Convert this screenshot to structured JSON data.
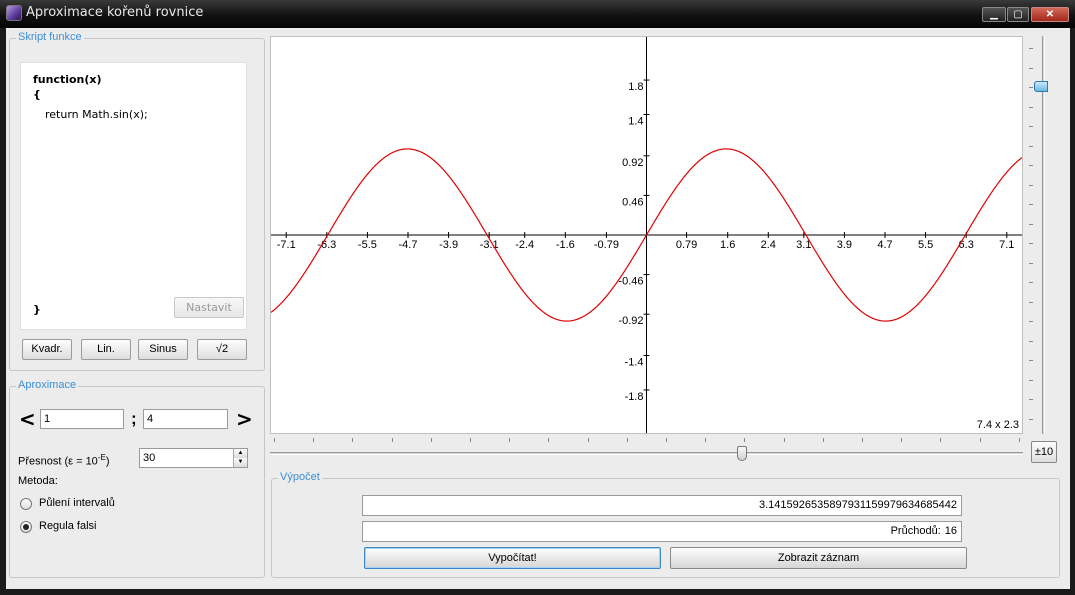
{
  "window": {
    "title": "Aproximace kořenů rovnice",
    "controls": {
      "minimize": "▁",
      "maximize": "▢",
      "close": "✕"
    }
  },
  "script_panel": {
    "title": "Skript funkce",
    "code_lines": [
      "function(x)",
      "{",
      "return Math.sin(x);",
      "}"
    ],
    "apply_button": "Nastavit",
    "preset_buttons": [
      "Kvadr.",
      "Lin.",
      "Sinus",
      "√2"
    ]
  },
  "approx_panel": {
    "title": "Aproximace",
    "prev_arrow": "<",
    "next_arrow": ">",
    "interval_from": "1",
    "interval_separator": ";",
    "interval_to": "4",
    "precision_label_pre": "Přesnost (ε = 10",
    "precision_label_exp": "-E",
    "precision_label_post": ")",
    "precision_value": "30",
    "method_label": "Metoda:",
    "methods": [
      {
        "label": "Půlení intervalů",
        "selected": false
      },
      {
        "label": "Regula falsi",
        "selected": true
      }
    ]
  },
  "plot": {
    "function": "sin",
    "x_ticks": [
      "-7.1",
      "-6.3",
      "-5.5",
      "-4.7",
      "-3.9",
      "-3.1",
      "-2.4",
      "-1.6",
      "-0.79",
      "0.79",
      "1.6",
      "2.4",
      "3.1",
      "3.9",
      "4.7",
      "5.5",
      "6.3",
      "7.1"
    ],
    "x_tick_values": [
      -7.1,
      -6.3,
      -5.5,
      -4.7,
      -3.9,
      -3.1,
      -2.4,
      -1.6,
      -0.79,
      0.79,
      1.6,
      2.4,
      3.1,
      3.9,
      4.7,
      5.5,
      6.3,
      7.1
    ],
    "y_ticks": [
      "1.8",
      "1.4",
      "0.92",
      "0.46",
      "-0.46",
      "-0.92",
      "-1.4",
      "-1.8"
    ],
    "y_tick_values": [
      1.8,
      1.4,
      0.92,
      0.46,
      -0.46,
      -0.92,
      -1.4,
      -1.8
    ],
    "x_range": [
      -7.4,
      7.4
    ],
    "y_range": [
      -2.3,
      2.3
    ],
    "line_color": "#e00000",
    "scale_label": "7.4 x 2.3",
    "zoom_button": "±10"
  },
  "result_panel": {
    "title": "Výpočet",
    "root_value": "3.14159265358979311599796346854​42",
    "passes_label": "Průchodů:",
    "passes_value": "16",
    "compute_button": "Vypočítat!",
    "log_button": "Zobrazit záznam"
  }
}
